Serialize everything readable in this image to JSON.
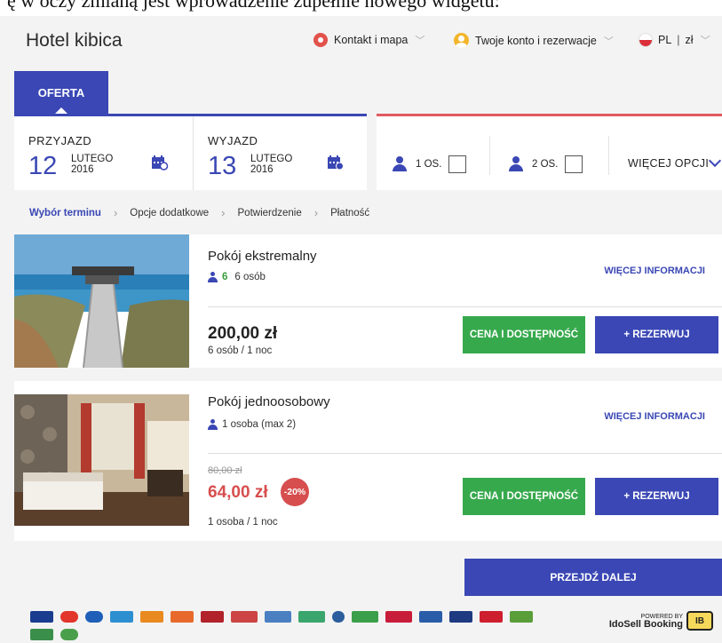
{
  "caption": "ę w oczy zmianą jest wprowadzenie zupełnie nowego widgetu:",
  "header": {
    "title": "Hotel kibica",
    "contact": "Kontakt i mapa",
    "account": "Twoje konto i rezerwacje",
    "language": "PL",
    "currency": "zł"
  },
  "tab": {
    "label": "OFERTA"
  },
  "arrival": {
    "label": "PRZYJAZD",
    "day": "12",
    "month": "LUTEGO",
    "year": "2016"
  },
  "departure": {
    "label": "WYJAZD",
    "day": "13",
    "month": "LUTEGO",
    "year": "2016"
  },
  "guests": {
    "one": "1 OS.",
    "two": "2 OS.",
    "more": "WIĘCEJ OPCJI"
  },
  "breadcrumb": [
    "Wybór terminu",
    "Opcje dodatkowe",
    "Potwierdzenie",
    "Płatność"
  ],
  "rooms": [
    {
      "name": "Pokój ekstremalny",
      "capacity_count": "6",
      "capacity": "6 osób",
      "more_info": "WIĘCEJ INFORMACJI",
      "price": "200,00 zł",
      "price_sub": "6 osób / 1 noc",
      "btn_price": "CENA I DOSTĘPNOŚĆ",
      "btn_book": "+ REZERWUJ"
    },
    {
      "name": "Pokój jednoosobowy",
      "capacity": "1 osoba (max 2)",
      "more_info": "WIĘCEJ INFORMACJI",
      "old_price": "80,00 zł",
      "price": "64,00 zł",
      "discount": "-20%",
      "price_sub": "1 osoba / 1 noc",
      "btn_price": "CENA I DOSTĘPNOŚĆ",
      "btn_book": "+ REZERWUJ"
    }
  ],
  "next_button": "PRZEJDŹ DALEJ",
  "powered": {
    "line1": "POWERED BY",
    "line2": "IdoSell Booking"
  },
  "colors": {
    "brand_blue": "#3a47b4",
    "green": "#37a94d",
    "red": "#d74e4e"
  }
}
